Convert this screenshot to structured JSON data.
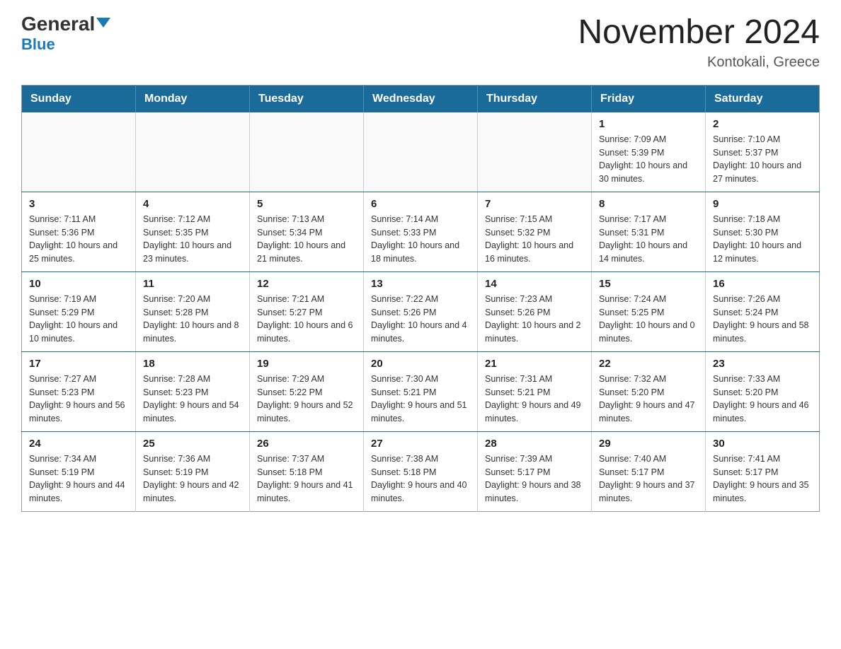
{
  "header": {
    "logo_general": "General",
    "logo_blue": "Blue",
    "month_title": "November 2024",
    "location": "Kontokali, Greece"
  },
  "days_of_week": [
    "Sunday",
    "Monday",
    "Tuesday",
    "Wednesday",
    "Thursday",
    "Friday",
    "Saturday"
  ],
  "weeks": [
    [
      {
        "day": "",
        "info": ""
      },
      {
        "day": "",
        "info": ""
      },
      {
        "day": "",
        "info": ""
      },
      {
        "day": "",
        "info": ""
      },
      {
        "day": "",
        "info": ""
      },
      {
        "day": "1",
        "info": "Sunrise: 7:09 AM\nSunset: 5:39 PM\nDaylight: 10 hours and 30 minutes."
      },
      {
        "day": "2",
        "info": "Sunrise: 7:10 AM\nSunset: 5:37 PM\nDaylight: 10 hours and 27 minutes."
      }
    ],
    [
      {
        "day": "3",
        "info": "Sunrise: 7:11 AM\nSunset: 5:36 PM\nDaylight: 10 hours and 25 minutes."
      },
      {
        "day": "4",
        "info": "Sunrise: 7:12 AM\nSunset: 5:35 PM\nDaylight: 10 hours and 23 minutes."
      },
      {
        "day": "5",
        "info": "Sunrise: 7:13 AM\nSunset: 5:34 PM\nDaylight: 10 hours and 21 minutes."
      },
      {
        "day": "6",
        "info": "Sunrise: 7:14 AM\nSunset: 5:33 PM\nDaylight: 10 hours and 18 minutes."
      },
      {
        "day": "7",
        "info": "Sunrise: 7:15 AM\nSunset: 5:32 PM\nDaylight: 10 hours and 16 minutes."
      },
      {
        "day": "8",
        "info": "Sunrise: 7:17 AM\nSunset: 5:31 PM\nDaylight: 10 hours and 14 minutes."
      },
      {
        "day": "9",
        "info": "Sunrise: 7:18 AM\nSunset: 5:30 PM\nDaylight: 10 hours and 12 minutes."
      }
    ],
    [
      {
        "day": "10",
        "info": "Sunrise: 7:19 AM\nSunset: 5:29 PM\nDaylight: 10 hours and 10 minutes."
      },
      {
        "day": "11",
        "info": "Sunrise: 7:20 AM\nSunset: 5:28 PM\nDaylight: 10 hours and 8 minutes."
      },
      {
        "day": "12",
        "info": "Sunrise: 7:21 AM\nSunset: 5:27 PM\nDaylight: 10 hours and 6 minutes."
      },
      {
        "day": "13",
        "info": "Sunrise: 7:22 AM\nSunset: 5:26 PM\nDaylight: 10 hours and 4 minutes."
      },
      {
        "day": "14",
        "info": "Sunrise: 7:23 AM\nSunset: 5:26 PM\nDaylight: 10 hours and 2 minutes."
      },
      {
        "day": "15",
        "info": "Sunrise: 7:24 AM\nSunset: 5:25 PM\nDaylight: 10 hours and 0 minutes."
      },
      {
        "day": "16",
        "info": "Sunrise: 7:26 AM\nSunset: 5:24 PM\nDaylight: 9 hours and 58 minutes."
      }
    ],
    [
      {
        "day": "17",
        "info": "Sunrise: 7:27 AM\nSunset: 5:23 PM\nDaylight: 9 hours and 56 minutes."
      },
      {
        "day": "18",
        "info": "Sunrise: 7:28 AM\nSunset: 5:23 PM\nDaylight: 9 hours and 54 minutes."
      },
      {
        "day": "19",
        "info": "Sunrise: 7:29 AM\nSunset: 5:22 PM\nDaylight: 9 hours and 52 minutes."
      },
      {
        "day": "20",
        "info": "Sunrise: 7:30 AM\nSunset: 5:21 PM\nDaylight: 9 hours and 51 minutes."
      },
      {
        "day": "21",
        "info": "Sunrise: 7:31 AM\nSunset: 5:21 PM\nDaylight: 9 hours and 49 minutes."
      },
      {
        "day": "22",
        "info": "Sunrise: 7:32 AM\nSunset: 5:20 PM\nDaylight: 9 hours and 47 minutes."
      },
      {
        "day": "23",
        "info": "Sunrise: 7:33 AM\nSunset: 5:20 PM\nDaylight: 9 hours and 46 minutes."
      }
    ],
    [
      {
        "day": "24",
        "info": "Sunrise: 7:34 AM\nSunset: 5:19 PM\nDaylight: 9 hours and 44 minutes."
      },
      {
        "day": "25",
        "info": "Sunrise: 7:36 AM\nSunset: 5:19 PM\nDaylight: 9 hours and 42 minutes."
      },
      {
        "day": "26",
        "info": "Sunrise: 7:37 AM\nSunset: 5:18 PM\nDaylight: 9 hours and 41 minutes."
      },
      {
        "day": "27",
        "info": "Sunrise: 7:38 AM\nSunset: 5:18 PM\nDaylight: 9 hours and 40 minutes."
      },
      {
        "day": "28",
        "info": "Sunrise: 7:39 AM\nSunset: 5:17 PM\nDaylight: 9 hours and 38 minutes."
      },
      {
        "day": "29",
        "info": "Sunrise: 7:40 AM\nSunset: 5:17 PM\nDaylight: 9 hours and 37 minutes."
      },
      {
        "day": "30",
        "info": "Sunrise: 7:41 AM\nSunset: 5:17 PM\nDaylight: 9 hours and 35 minutes."
      }
    ]
  ]
}
